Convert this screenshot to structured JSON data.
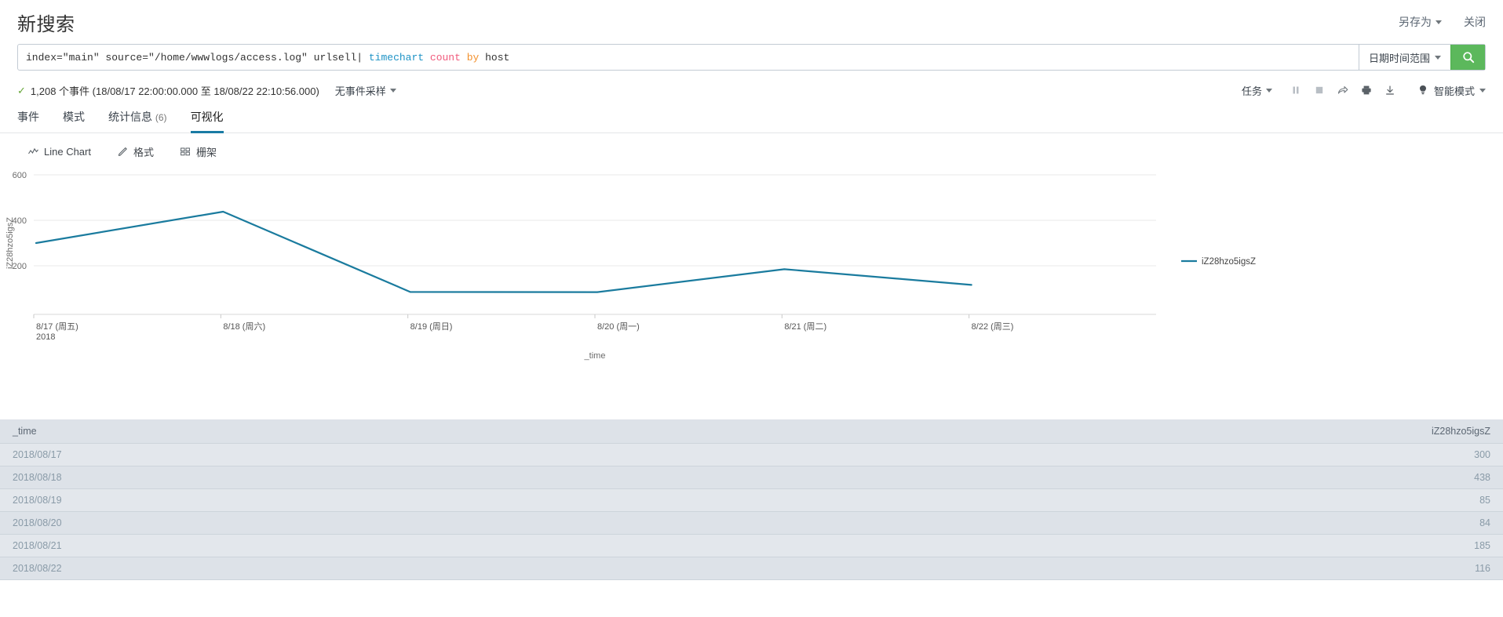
{
  "header": {
    "title": "新搜索",
    "save_as_label": "另存为",
    "close_label": "关闭"
  },
  "search": {
    "query_full": "index=\"main\" source=\"/home/wwwlogs/access.log\" urlsell| timechart count by host",
    "tokens": {
      "base": "index=\"main\" source=\"/home/wwwlogs/access.log\" urlsell|",
      "command": " timechart",
      "func": " count",
      "keyword": " by",
      "field": " host"
    },
    "time_range_label": "日期时间范围",
    "search_icon": "search-icon",
    "search_button_color": "#5cb85c"
  },
  "results_bar": {
    "check_glyph": "✓",
    "event_count_text": "1,208 个事件 (18/08/17 22:00:00.000 至 18/08/22 22:10:56.000)",
    "sampling_label": "无事件采样",
    "job_label": "任务",
    "icons": [
      "pause-icon",
      "stop-icon",
      "share-icon",
      "print-icon",
      "export-icon"
    ],
    "mode_label": "智能模式",
    "mode_icon": "lightbulb-icon"
  },
  "tabs": [
    {
      "label": "事件",
      "count": "",
      "active": false
    },
    {
      "label": "模式",
      "count": "",
      "active": false
    },
    {
      "label": "统计信息",
      "count": "(6)",
      "active": false
    },
    {
      "label": "可视化",
      "count": "",
      "active": true
    }
  ],
  "chart_toolbar": {
    "type_label": "Line Chart",
    "format_label": "格式",
    "trellis_label": "栅架"
  },
  "chart_data": {
    "type": "line",
    "title": "",
    "xlabel": "_time",
    "ylabel": "iZ28hzo5igsZ",
    "categories": [
      "8/17 (周五)",
      "8/18 (周六)",
      "8/19 (周日)",
      "8/20 (周一)",
      "8/21 (周二)",
      "8/22 (周三)"
    ],
    "x_sub_label": "2018",
    "series": [
      {
        "name": "iZ28hzo5igsZ",
        "color": "#1a7b9e",
        "values": [
          300,
          438,
          85,
          84,
          185,
          116
        ]
      }
    ],
    "ylim": [
      0,
      600
    ],
    "yticks": [
      200,
      400,
      600
    ],
    "grid": true,
    "legend_position": "right",
    "legend_entries": [
      "iZ28hzo5igsZ"
    ]
  },
  "table": {
    "columns": [
      "_time",
      "iZ28hzo5igsZ"
    ],
    "rows": [
      [
        "2018/08/17",
        "300"
      ],
      [
        "2018/08/18",
        "438"
      ],
      [
        "2018/08/19",
        "85"
      ],
      [
        "2018/08/20",
        "84"
      ],
      [
        "2018/08/21",
        "185"
      ],
      [
        "2018/08/22",
        "116"
      ]
    ]
  }
}
